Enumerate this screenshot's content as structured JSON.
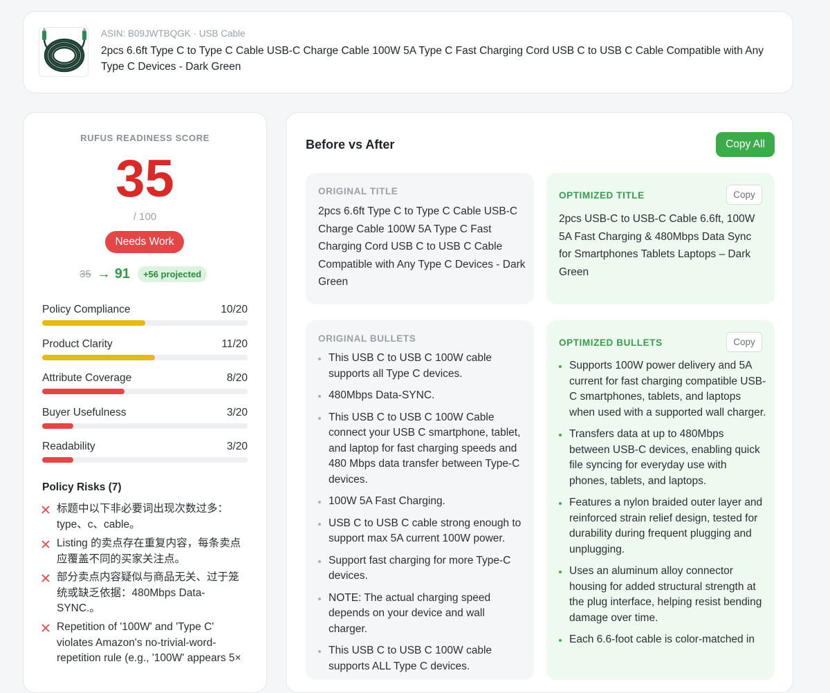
{
  "product": {
    "meta": "ASIN: B09JWTBQGK · USB Cable",
    "title": "2pcs 6.6ft Type C to Type C Cable USB-C Charge Cable 100W 5A Type C Fast Charging Cord USB C to USB C Cable Compatible with Any Type C Devices - Dark Green",
    "thumbnail_icon": "usb-c-cable-thumbnail"
  },
  "score": {
    "label": "RUFUS READINESS SCORE",
    "value": "35",
    "max": "/ 100",
    "status": "Needs Work",
    "projection": {
      "from": "35",
      "arrow": "→",
      "to": "91",
      "badge": "+56 projected"
    },
    "metrics": [
      {
        "label": "Policy Compliance",
        "value": "10/20",
        "fraction": 0.5,
        "color": "#e8b814"
      },
      {
        "label": "Product Clarity",
        "value": "11/20",
        "fraction": 0.55,
        "color": "#e8b814"
      },
      {
        "label": "Attribute Coverage",
        "value": "8/20",
        "fraction": 0.4,
        "color": "#e34646"
      },
      {
        "label": "Buyer Usefulness",
        "value": "3/20",
        "fraction": 0.15,
        "color": "#e34646"
      },
      {
        "label": "Readability",
        "value": "3/20",
        "fraction": 0.15,
        "color": "#e34646"
      }
    ],
    "risks_title": "Policy Risks (7)",
    "risks": [
      "标题中以下非必要词出现次数过多：type、c、cable。",
      "Listing 的卖点存在重复内容，每条卖点应覆盖不同的买家关注点。",
      "部分卖点内容疑似与商品无关、过于笼统或缺乏依据：480Mbps Data-SYNC.。",
      "Repetition of '100W' and 'Type C' violates Amazon's no-trivial-word-repetition rule (e.g., '100W' appears 5×"
    ]
  },
  "compare": {
    "title": "Before vs After",
    "copy_all": "Copy All",
    "original_title_label": "ORIGINAL TITLE",
    "original_title": "2pcs 6.6ft Type C to Type C Cable USB-C Charge Cable 100W 5A Type C Fast Charging Cord USB C to USB C Cable Compatible with Any Type C Devices - Dark Green",
    "optimized_title_label": "OPTIMIZED TITLE",
    "optimized_title": "2pcs USB-C to USB-C Cable 6.6ft, 100W 5A Fast Charging & 480Mbps Data Sync for Smartphones Tablets Laptops – Dark Green",
    "copy_label": "Copy",
    "original_bullets_label": "ORIGINAL BULLETS",
    "original_bullets": [
      "This USB C to USB C 100W cable supports all Type C devices.",
      "480Mbps Data-SYNC.",
      "This USB C to USB C 100W Cable connect your USB C smartphone, tablet, and laptop for fast charging speeds and 480 Mbps data transfer between Type-C devices.",
      "100W 5A Fast Charging.",
      "USB C to USB C cable strong enough to support max 5A current 100W power.",
      "Support fast charging for more Type-C devices.",
      "NOTE: The actual charging speed depends on your device and wall charger.",
      "This USB C to USB C 100W cable supports ALL Type C devices."
    ],
    "optimized_bullets_label": "OPTIMIZED BULLETS",
    "optimized_bullets": [
      "Supports 100W power delivery and 5A current for fast charging compatible USB-C smartphones, tablets, and laptops when used with a supported wall charger.",
      "Transfers data at up to 480Mbps between USB-C devices, enabling quick file syncing for everyday use with phones, tablets, and laptops.",
      "Features a nylon braided outer layer and reinforced strain relief design, tested for durability during frequent plugging and unplugging.",
      "Uses an aluminum alloy connector housing for added structural strength at the plug interface, helping resist bending damage over time.",
      "Each 6.6-foot cable is color-matched in"
    ]
  }
}
